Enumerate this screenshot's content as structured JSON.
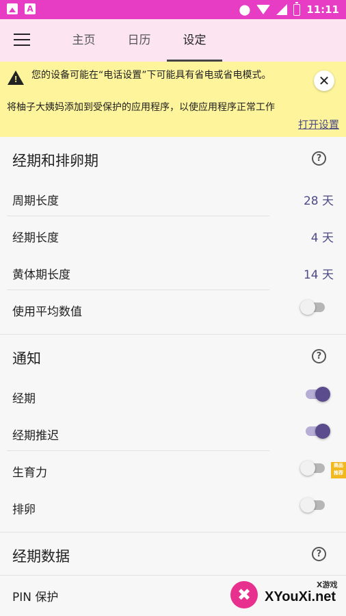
{
  "status_bar": {
    "time": "11:11",
    "left_icons": [
      "image-icon",
      "a-icon"
    ]
  },
  "tabs": [
    {
      "label": "主页",
      "active": false
    },
    {
      "label": "日历",
      "active": false
    },
    {
      "label": "设定",
      "active": true
    }
  ],
  "banner": {
    "line1": "您的设备可能在“电话设置”下可能具有省电或省电模式。",
    "line2": "将柚子大姨妈添加到受保护的应用程序，以使应用程序正常工作",
    "action": "打开设置"
  },
  "sections": {
    "period": {
      "title": "经期和排卵期",
      "rows": [
        {
          "label": "周期长度",
          "value": "28 天"
        },
        {
          "label": "经期长度",
          "value": "4 天"
        },
        {
          "label": "黄体期长度",
          "value": "14 天"
        },
        {
          "label": "使用平均数值",
          "toggle": "off"
        }
      ]
    },
    "notify": {
      "title": "通知",
      "rows": [
        {
          "label": "经期",
          "toggle": "on"
        },
        {
          "label": "经期推迟",
          "toggle": "on"
        },
        {
          "label": "生育力",
          "toggle": "off"
        },
        {
          "label": "排卵",
          "toggle": "off"
        }
      ]
    },
    "data": {
      "title": "经期数据",
      "rows": [
        {
          "label": "PIN 保护"
        }
      ]
    }
  },
  "side_tag": "商品 推荐",
  "watermark": {
    "text": "XYouXi.net",
    "small": "X游戏"
  },
  "colors": {
    "status_bar": "#e63dc4",
    "app_bar": "#fce4f1",
    "banner": "#fdf49b",
    "accent": "#4c4a87",
    "switch_on": "#5b4c8e"
  }
}
